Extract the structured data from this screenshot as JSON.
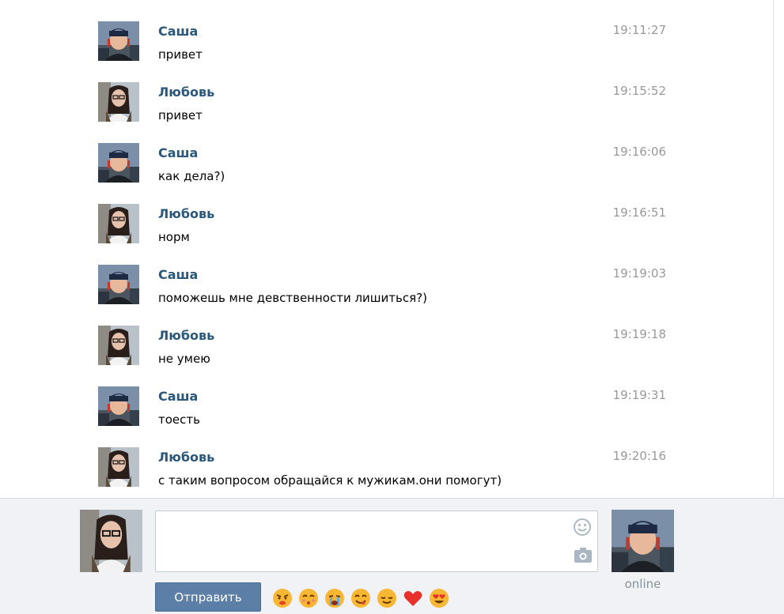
{
  "messages": [
    {
      "author": "Саша",
      "text": "привет",
      "time": "19:11:27",
      "avatar": "sasha"
    },
    {
      "author": "Любовь",
      "text": "привет",
      "time": "19:15:52",
      "avatar": "lubov"
    },
    {
      "author": "Саша",
      "text": "как дела?)",
      "time": "19:16:06",
      "avatar": "sasha"
    },
    {
      "author": "Любовь",
      "text": "норм",
      "time": "19:16:51",
      "avatar": "lubov"
    },
    {
      "author": "Саша",
      "text": "поможешь мне девственности лишиться?)",
      "time": "19:19:03",
      "avatar": "sasha"
    },
    {
      "author": "Любовь",
      "text": "не умею",
      "time": "19:19:18",
      "avatar": "lubov"
    },
    {
      "author": "Саша",
      "text": "тоесть",
      "time": "19:19:31",
      "avatar": "sasha"
    },
    {
      "author": "Любовь",
      "text": "с таким вопросом обращайся к мужикам.они помогут)",
      "time": "19:20:16",
      "avatar": "lubov"
    }
  ],
  "composer": {
    "input_value": "",
    "send_label": "Отправить",
    "smile_icon": "smile-icon",
    "camera_icon": "camera-icon",
    "emojis": [
      "angry-face-emoji",
      "kissing-face-emoji",
      "crying-face-emoji",
      "yum-face-emoji",
      "relieved-face-emoji",
      "red-heart-emoji",
      "heart-eyes-emoji"
    ]
  },
  "peer": {
    "status": "online"
  },
  "colors": {
    "name": "#2b587a",
    "time": "#999999",
    "send_button": "#5b7fa6",
    "composer_bg": "#f0f2f5"
  }
}
